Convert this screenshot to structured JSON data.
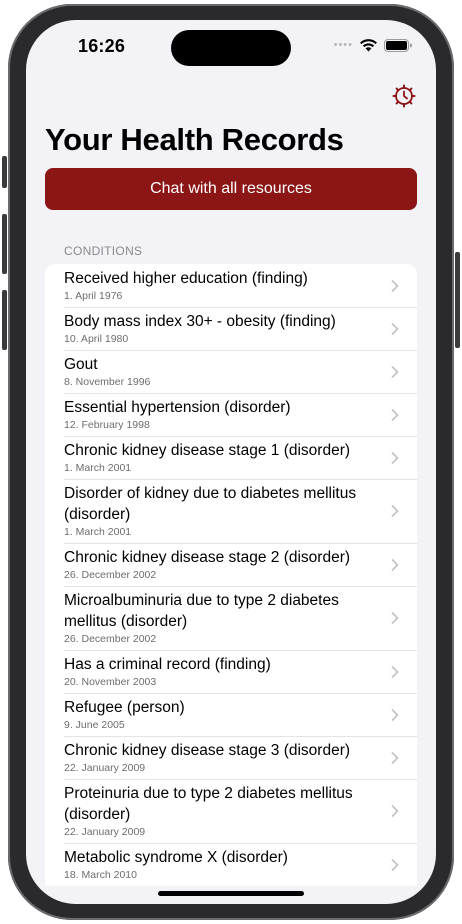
{
  "status_bar": {
    "time": "16:26",
    "signal_dots": "••••"
  },
  "header": {
    "title": "Your Health Records",
    "settings_icon": "gear-clock-icon"
  },
  "chat_button": {
    "label": "Chat with all resources"
  },
  "conditions": {
    "section_label": "CONDITIONS",
    "items": [
      {
        "title": "Received higher education (finding)",
        "date": "1. April 1976"
      },
      {
        "title": "Body mass index 30+ - obesity (finding)",
        "date": "10. April 1980"
      },
      {
        "title": "Gout",
        "date": "8. November 1996"
      },
      {
        "title": "Essential hypertension (disorder)",
        "date": "12. February 1998"
      },
      {
        "title": "Chronic kidney disease stage 1 (disorder)",
        "date": "1. March 2001"
      },
      {
        "title": "Disorder of kidney due to diabetes mellitus (disorder)",
        "date": "1. March 2001"
      },
      {
        "title": "Chronic kidney disease stage 2 (disorder)",
        "date": "26. December 2002"
      },
      {
        "title": "Microalbuminuria due to type 2 diabetes mellitus (disorder)",
        "date": "26. December 2002"
      },
      {
        "title": "Has a criminal record (finding)",
        "date": "20. November 2003"
      },
      {
        "title": "Refugee (person)",
        "date": "9. June 2005"
      },
      {
        "title": "Chronic kidney disease stage 3 (disorder)",
        "date": "22. January 2009"
      },
      {
        "title": "Proteinuria due to type 2 diabetes mellitus (disorder)",
        "date": "22. January 2009"
      },
      {
        "title": "Metabolic syndrome X (disorder)",
        "date": "18. March 2010"
      }
    ]
  },
  "colors": {
    "accent": "#8c1515",
    "background": "#f2f2f7"
  }
}
